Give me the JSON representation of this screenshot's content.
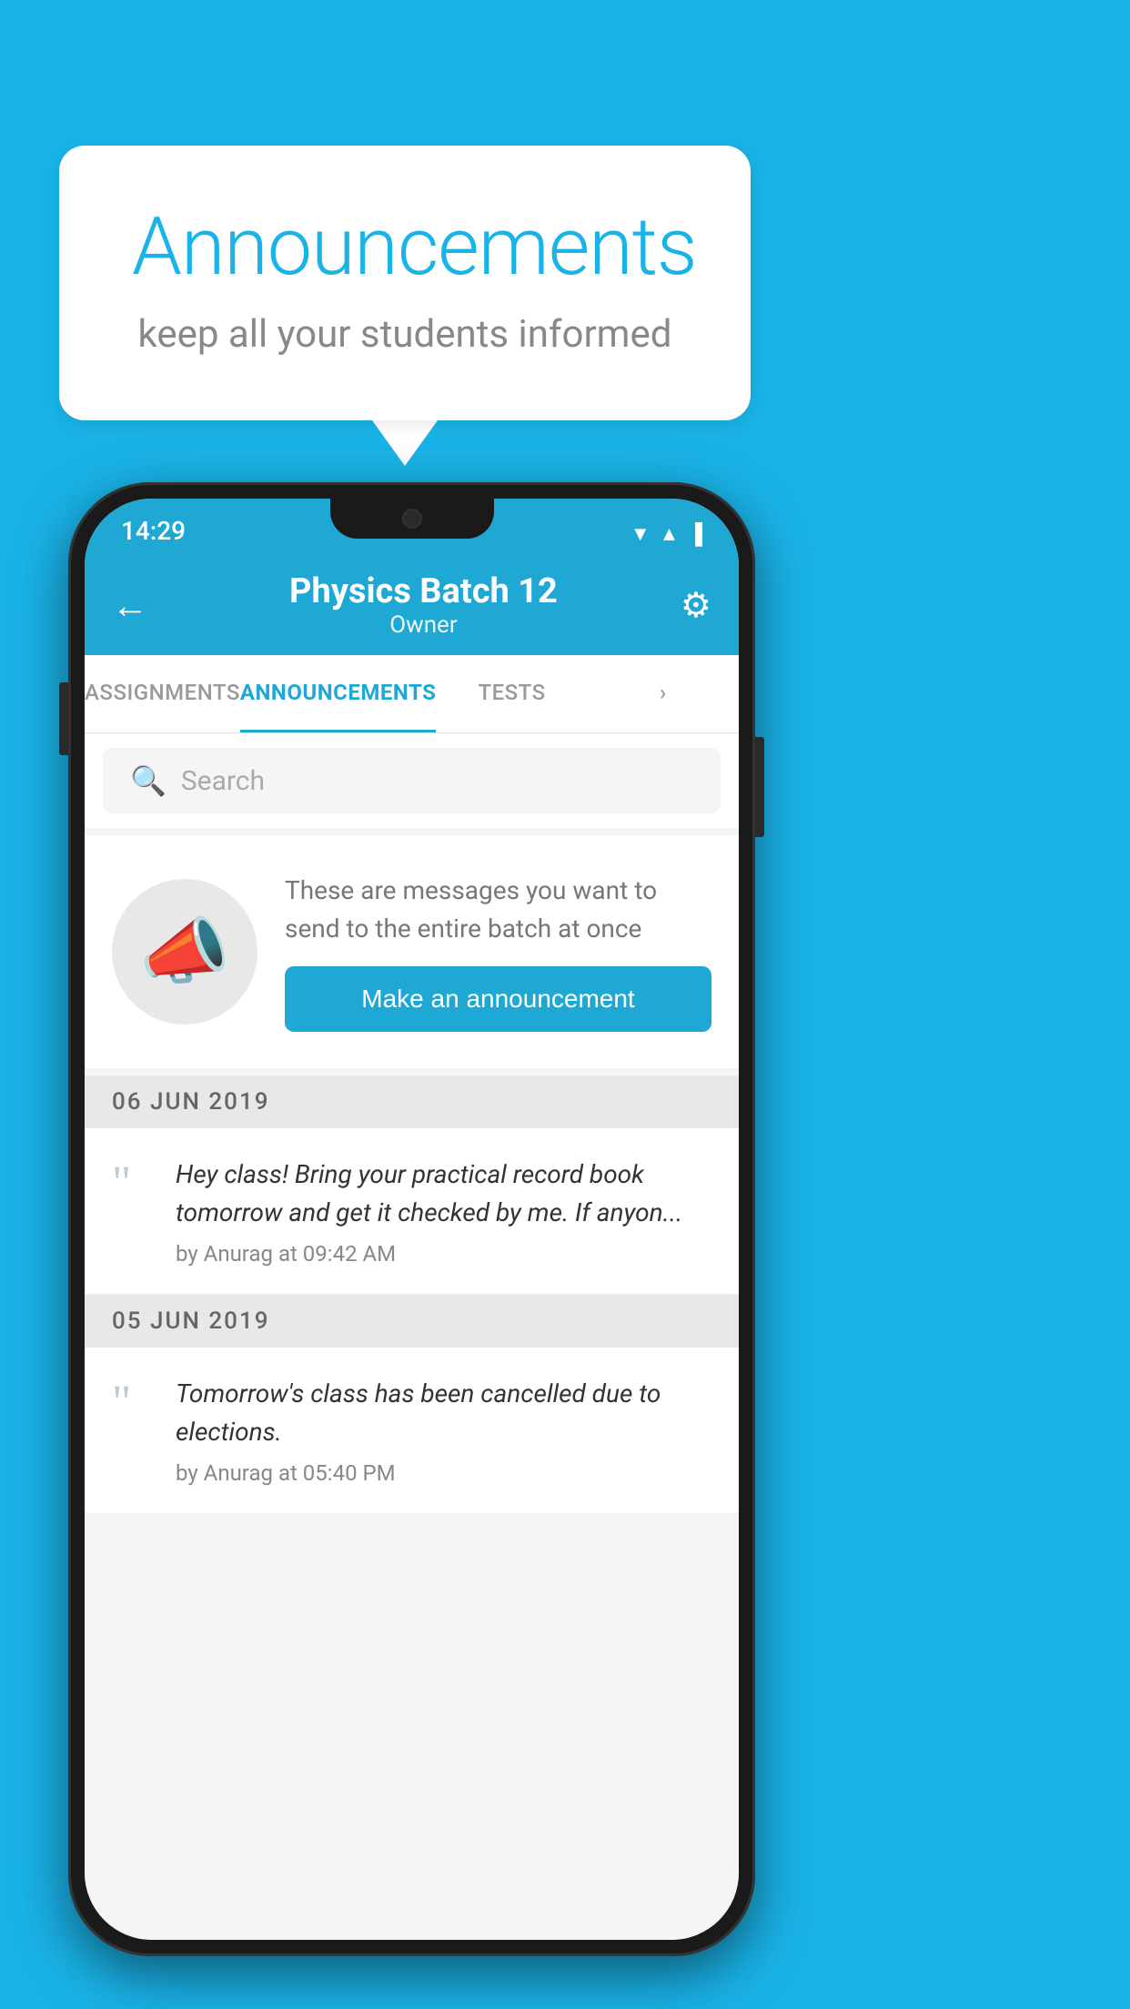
{
  "background_color": "#1ab3e8",
  "speech_bubble": {
    "title": "Announcements",
    "subtitle": "keep all your students informed"
  },
  "status_bar": {
    "time": "14:29",
    "icons": [
      "wifi",
      "signal",
      "battery"
    ]
  },
  "app_bar": {
    "title": "Physics Batch 12",
    "subtitle": "Owner",
    "back_label": "←",
    "settings_label": "⚙"
  },
  "tabs": [
    {
      "label": "ASSIGNMENTS",
      "active": false
    },
    {
      "label": "ANNOUNCEMENTS",
      "active": true
    },
    {
      "label": "TESTS",
      "active": false
    },
    {
      "label": "MORE",
      "active": false
    }
  ],
  "search": {
    "placeholder": "Search"
  },
  "announcement_prompt": {
    "description": "These are messages you want to send to the entire batch at once",
    "button_label": "Make an announcement"
  },
  "announcements": [
    {
      "date": "06  JUN  2019",
      "items": [
        {
          "text": "Hey class! Bring your practical record book tomorrow and get it checked by me. If anyon...",
          "author": "by Anurag at 09:42 AM"
        }
      ]
    },
    {
      "date": "05  JUN  2019",
      "items": [
        {
          "text": "Tomorrow's class has been cancelled due to elections.",
          "author": "by Anurag at 05:40 PM"
        }
      ]
    }
  ]
}
